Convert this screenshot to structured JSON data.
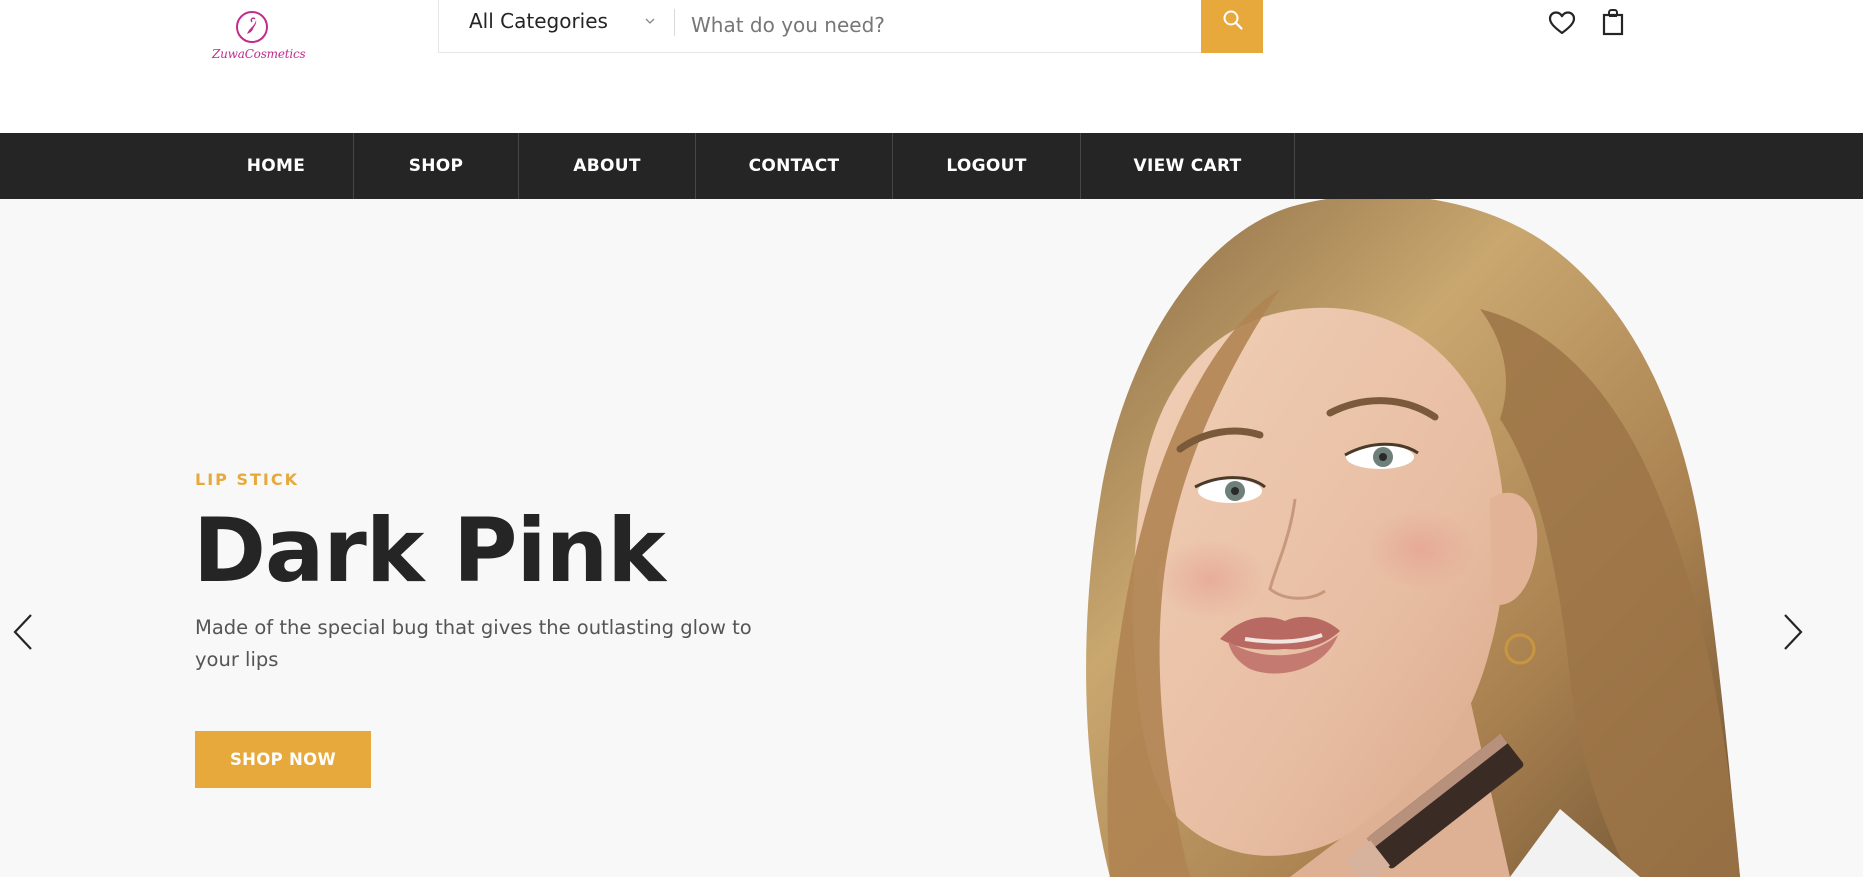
{
  "brand": {
    "logo_text": "ZuwaCosmetics",
    "color": "#c02c8e"
  },
  "search": {
    "category_selected": "All Categories",
    "placeholder": "What do you need?",
    "icon": "search-icon"
  },
  "header_icons": [
    "heart-icon",
    "shopping-bag-icon"
  ],
  "nav": {
    "items": [
      {
        "label": "HOME"
      },
      {
        "label": "SHOP"
      },
      {
        "label": "ABOUT"
      },
      {
        "label": "CONTACT"
      },
      {
        "label": "LOGOUT"
      },
      {
        "label": "VIEW CART"
      }
    ]
  },
  "hero": {
    "subtitle": "LIP STICK",
    "title": "Dark Pink",
    "description": "Made of the special bug that gives the outlasting glow to your lips",
    "button_label": "SHOP NOW",
    "prev_icon": "chevron-left-icon",
    "next_icon": "chevron-right-icon"
  },
  "colors": {
    "accent": "#e7a93b",
    "nav_background": "#252525",
    "hero_background": "#f8f8f8",
    "text_dark": "#252525"
  }
}
